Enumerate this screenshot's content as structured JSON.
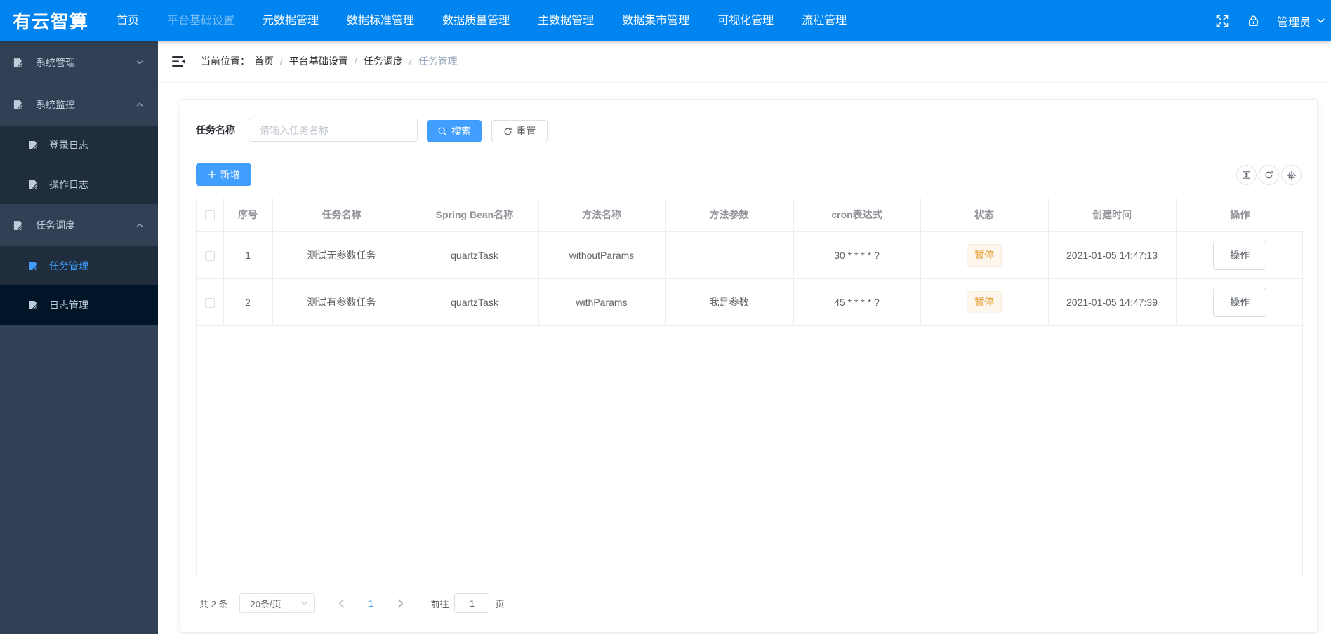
{
  "brand": {
    "name": "有云智算"
  },
  "topnav": {
    "items": [
      {
        "label": "首页",
        "dimmed": false
      },
      {
        "label": "平台基础设置",
        "dimmed": true
      },
      {
        "label": "元数据管理",
        "dimmed": false
      },
      {
        "label": "数据标准管理",
        "dimmed": false
      },
      {
        "label": "数据质量管理",
        "dimmed": false
      },
      {
        "label": "主数据管理",
        "dimmed": false
      },
      {
        "label": "数据集市管理",
        "dimmed": false
      },
      {
        "label": "可视化管理",
        "dimmed": false
      },
      {
        "label": "流程管理",
        "dimmed": false
      }
    ]
  },
  "topbar_right": {
    "user_label": "管理员"
  },
  "sidebar": {
    "groups": [
      {
        "label": "系统管理",
        "expanded": false
      },
      {
        "label": "系统监控",
        "expanded": true
      },
      {
        "label": "任务调度",
        "expanded": true
      }
    ],
    "monitor_children": [
      {
        "label": "登录日志"
      },
      {
        "label": "操作日志"
      }
    ],
    "schedule_children": [
      {
        "label": "任务管理",
        "active": true
      },
      {
        "label": "日志管理",
        "active": false
      }
    ]
  },
  "breadcrumb": {
    "prefix": "当前位置：",
    "separator": "/",
    "items": [
      "首页",
      "平台基础设置",
      "任务调度",
      "任务管理"
    ]
  },
  "search": {
    "label": "任务名称",
    "placeholder": "请输入任务名称",
    "value": "",
    "search_label": "搜索",
    "reset_label": "重置"
  },
  "toolbar": {
    "add_label": "新增"
  },
  "table": {
    "columns": [
      "序号",
      "任务名称",
      "Spring Bean名称",
      "方法名称",
      "方法参数",
      "cron表达式",
      "状态",
      "创建时间",
      "操作"
    ],
    "rows": [
      {
        "index": "1",
        "name": "测试无参数任务",
        "bean": "quartzTask",
        "method": "withoutParams",
        "params": "",
        "cron": "30 * * * * ?",
        "status": "暂停",
        "created": "2021-01-05 14:47:13",
        "action": "操作"
      },
      {
        "index": "2",
        "name": "测试有参数任务",
        "bean": "quartzTask",
        "method": "withParams",
        "params": "我是参数",
        "cron": "45 * * * * ?",
        "status": "暂停",
        "created": "2021-01-05 14:47:39",
        "action": "操作"
      }
    ]
  },
  "pagination": {
    "total": "共 2 条",
    "page_size": "20条/页",
    "current": "1",
    "goto_label": "前往",
    "page_suffix": "页"
  },
  "colors": {
    "topbar": "#0084f0",
    "primary": "#409eff",
    "sidebar_bg": "#304156",
    "sidebar_sub_bg": "#1f2d3d",
    "sidebar_hover_bg": "#001528",
    "warning_text": "#e6a23c",
    "warning_bg": "#fdf6ec",
    "warning_border": "#faecd8"
  }
}
